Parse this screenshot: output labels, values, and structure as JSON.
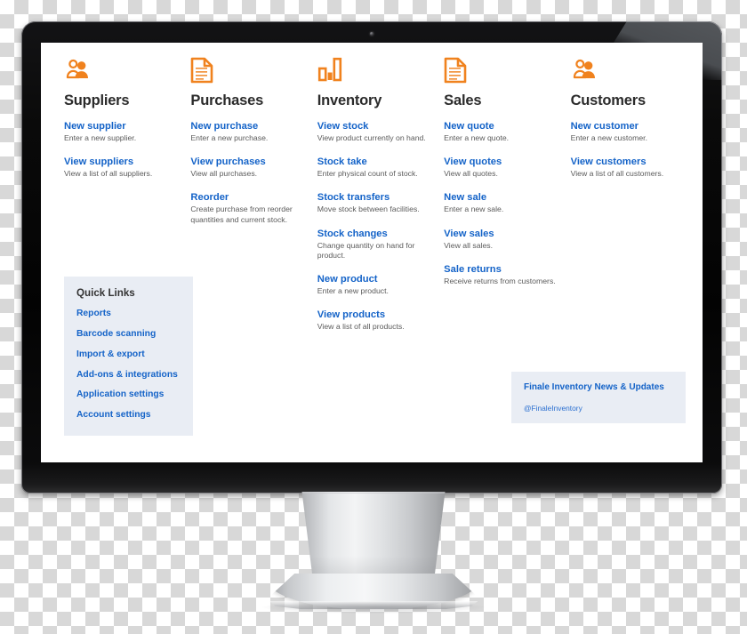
{
  "app": {
    "screen_background": "#ffffff",
    "link_color": "#1463c8",
    "icon_color": "#f0821e",
    "panel_background": "#e9edf4"
  },
  "columns": [
    {
      "id": "suppliers",
      "title": "Suppliers",
      "icon": "users-icon",
      "links": [
        {
          "label": "New supplier",
          "desc": "Enter a new supplier."
        },
        {
          "label": "View suppliers",
          "desc": "View a list of all suppliers."
        }
      ]
    },
    {
      "id": "purchases",
      "title": "Purchases",
      "icon": "document-icon",
      "links": [
        {
          "label": "New purchase",
          "desc": "Enter a new purchase."
        },
        {
          "label": "View purchases",
          "desc": "View all purchases."
        },
        {
          "label": "Reorder",
          "desc": "Create purchase from reorder quantities and current stock."
        }
      ]
    },
    {
      "id": "inventory",
      "title": "Inventory",
      "icon": "bar-chart-icon",
      "links": [
        {
          "label": "View stock",
          "desc": "View product currently on hand."
        },
        {
          "label": "Stock take",
          "desc": "Enter physical count of stock."
        },
        {
          "label": "Stock transfers",
          "desc": "Move stock between facilities."
        },
        {
          "label": "Stock changes",
          "desc": "Change quantity on hand for product."
        },
        {
          "label": "New product",
          "desc": "Enter a new product."
        },
        {
          "label": "View products",
          "desc": "View a list of all products."
        }
      ]
    },
    {
      "id": "sales",
      "title": "Sales",
      "icon": "document-icon",
      "links": [
        {
          "label": "New quote",
          "desc": "Enter a new quote."
        },
        {
          "label": "View quotes",
          "desc": "View all quotes."
        },
        {
          "label": "New sale",
          "desc": "Enter a new sale."
        },
        {
          "label": "View sales",
          "desc": "View all sales."
        },
        {
          "label": "Sale returns",
          "desc": "Receive returns from customers."
        }
      ]
    },
    {
      "id": "customers",
      "title": "Customers",
      "icon": "users-icon",
      "links": [
        {
          "label": "New customer",
          "desc": "Enter a new customer."
        },
        {
          "label": "View customers",
          "desc": "View a list of all customers."
        }
      ]
    }
  ],
  "quick_links": {
    "title": "Quick Links",
    "items": [
      "Reports",
      "Barcode scanning",
      "Import & export",
      "Add-ons & integrations",
      "Application settings",
      "Account settings"
    ]
  },
  "news_panel": {
    "title": "Finale Inventory News & Updates",
    "handle": "@FinaleInventory"
  }
}
